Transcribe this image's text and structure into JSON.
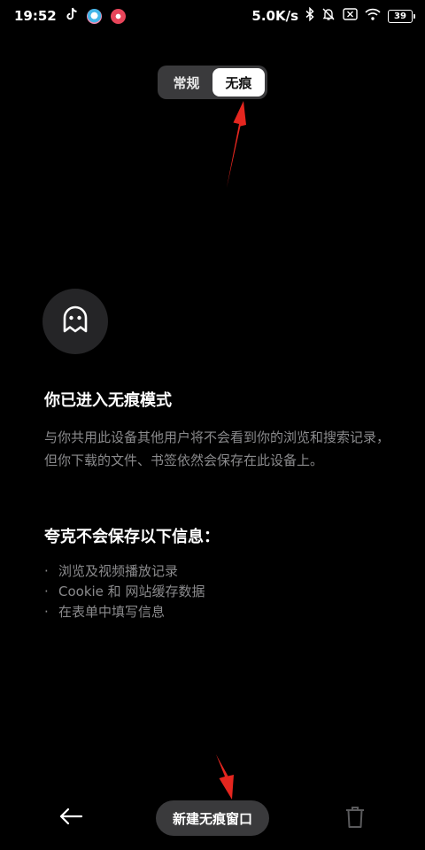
{
  "status_bar": {
    "time": "19:52",
    "network_speed": "5.0K/s",
    "battery_level": "39",
    "app_icons": [
      "tiktok-icon",
      "app-icon",
      "music-app-icon"
    ],
    "status_icons": [
      "bluetooth-icon",
      "mute-bell-icon",
      "no-sim-icon",
      "wifi-icon",
      "battery-icon"
    ]
  },
  "mode_toggle": {
    "options": [
      "常规",
      "无痕"
    ],
    "selected": "无痕"
  },
  "incognito_info": {
    "icon": "ghost-icon",
    "title": "你已进入无痕模式",
    "description": "与你共用此设备其他用户将不会看到你的浏览和搜索记录，但你下载的文件、书签依然会保存在此设备上。"
  },
  "not_saved": {
    "title": "夸克不会保存以下信息：",
    "items": [
      "浏览及视频播放记录",
      "Cookie 和 网站缓存数据",
      "在表单中填写信息"
    ]
  },
  "bottom_bar": {
    "back_icon": "back-arrow-icon",
    "new_window_label": "新建无痕窗口",
    "trash_icon": "trash-icon"
  },
  "colors": {
    "background": "#000000",
    "surface": "#3a3a3c",
    "muted_text": "#8a8a8c",
    "annotation_arrow": "#e5261f"
  }
}
